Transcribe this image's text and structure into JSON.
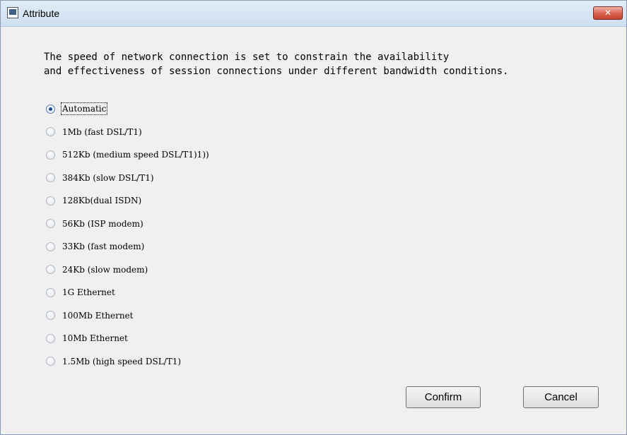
{
  "window": {
    "title": "Attribute",
    "close_label": "✕"
  },
  "description": {
    "line1": "The speed of network connection is set to constrain the availability",
    "line2": "and effectiveness of session connections under different bandwidth conditions."
  },
  "options": [
    {
      "label": "Automatic",
      "checked": true
    },
    {
      "label": "1Mb (fast DSL/T1)",
      "checked": false
    },
    {
      "label": "512Kb (medium speed DSL/T1)1))",
      "checked": false
    },
    {
      "label": "384Kb (slow DSL/T1)",
      "checked": false
    },
    {
      "label": "128Kb(dual ISDN)",
      "checked": false
    },
    {
      "label": "56Kb (ISP modem)",
      "checked": false
    },
    {
      "label": "33Kb (fast modem)",
      "checked": false
    },
    {
      "label": "24Kb (slow modem)",
      "checked": false
    },
    {
      "label": "1G Ethernet",
      "checked": false
    },
    {
      "label": "100Mb Ethernet",
      "checked": false
    },
    {
      "label": "10Mb Ethernet",
      "checked": false
    },
    {
      "label": "1.5Mb (high speed DSL/T1)",
      "checked": false
    }
  ],
  "buttons": {
    "confirm": "Confirm",
    "cancel": "Cancel"
  }
}
